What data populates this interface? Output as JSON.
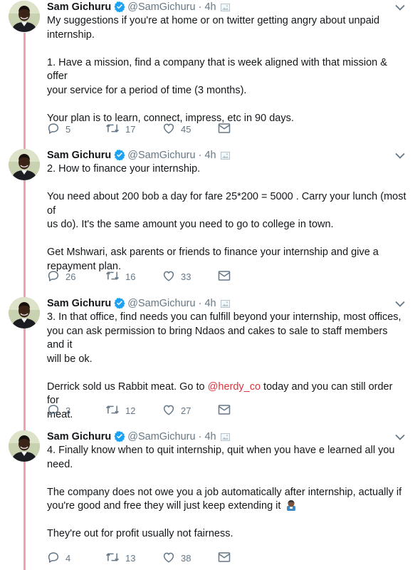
{
  "tweets": [
    {
      "name": "Sam Gichuru",
      "handle": "@SamGichuru",
      "sep": "·",
      "time": "4h",
      "lines": [
        "My suggestions if you're at home or on twitter getting angry about unpaid",
        "internship.",
        "",
        "1. Have a mission, find a company that is week aligned with that mission & offer",
        "your service for a period of time (3 months).",
        "",
        "Your plan is to learn, connect, impress, etc in 90 days."
      ],
      "replies": "5",
      "retweets": "17",
      "likes": "45"
    },
    {
      "name": "Sam Gichuru",
      "handle": "@SamGichuru",
      "sep": "·",
      "time": "4h",
      "lines": [
        "2. How to finance your internship.",
        "",
        "You need about 200 bob a day for fare 25*200 = 5000 . Carry your lunch (most of",
        "us do). It's the same amount you need to go to college in town.",
        "",
        "Get Mshwari, ask parents or friends to finance your internship and give a",
        "repayment plan."
      ],
      "replies": "26",
      "retweets": "16",
      "likes": "33"
    },
    {
      "name": "Sam Gichuru",
      "handle": "@SamGichuru",
      "sep": "·",
      "time": "4h",
      "lines": [
        "3. In that office, find needs you can fulfill beyond your internship, most offices,",
        "you can ask permission to bring Ndaos and cakes to sale to staff members and it",
        "will be ok.",
        ""
      ],
      "mention_line": {
        "before": "Derrick sold us Rabbit meat. Go to ",
        "mention": "@herdy_co",
        "after": " today and you can still order for"
      },
      "last_line": "meat.",
      "replies": "3",
      "retweets": "12",
      "likes": "27"
    },
    {
      "name": "Sam Gichuru",
      "handle": "@SamGichuru",
      "sep": "·",
      "time": "4h",
      "lines": [
        "4. Finally know when to quit internship, quit when you have e learned all you",
        "need.",
        "",
        "The company does not owe you a job automatically after internship, actually if"
      ],
      "emoji_line": "you're good and free they will just keep extending it ",
      "lines_after": [
        "",
        "They're out for profit usually not fairness."
      ],
      "replies": "4",
      "retweets": "13",
      "likes": "38"
    }
  ]
}
